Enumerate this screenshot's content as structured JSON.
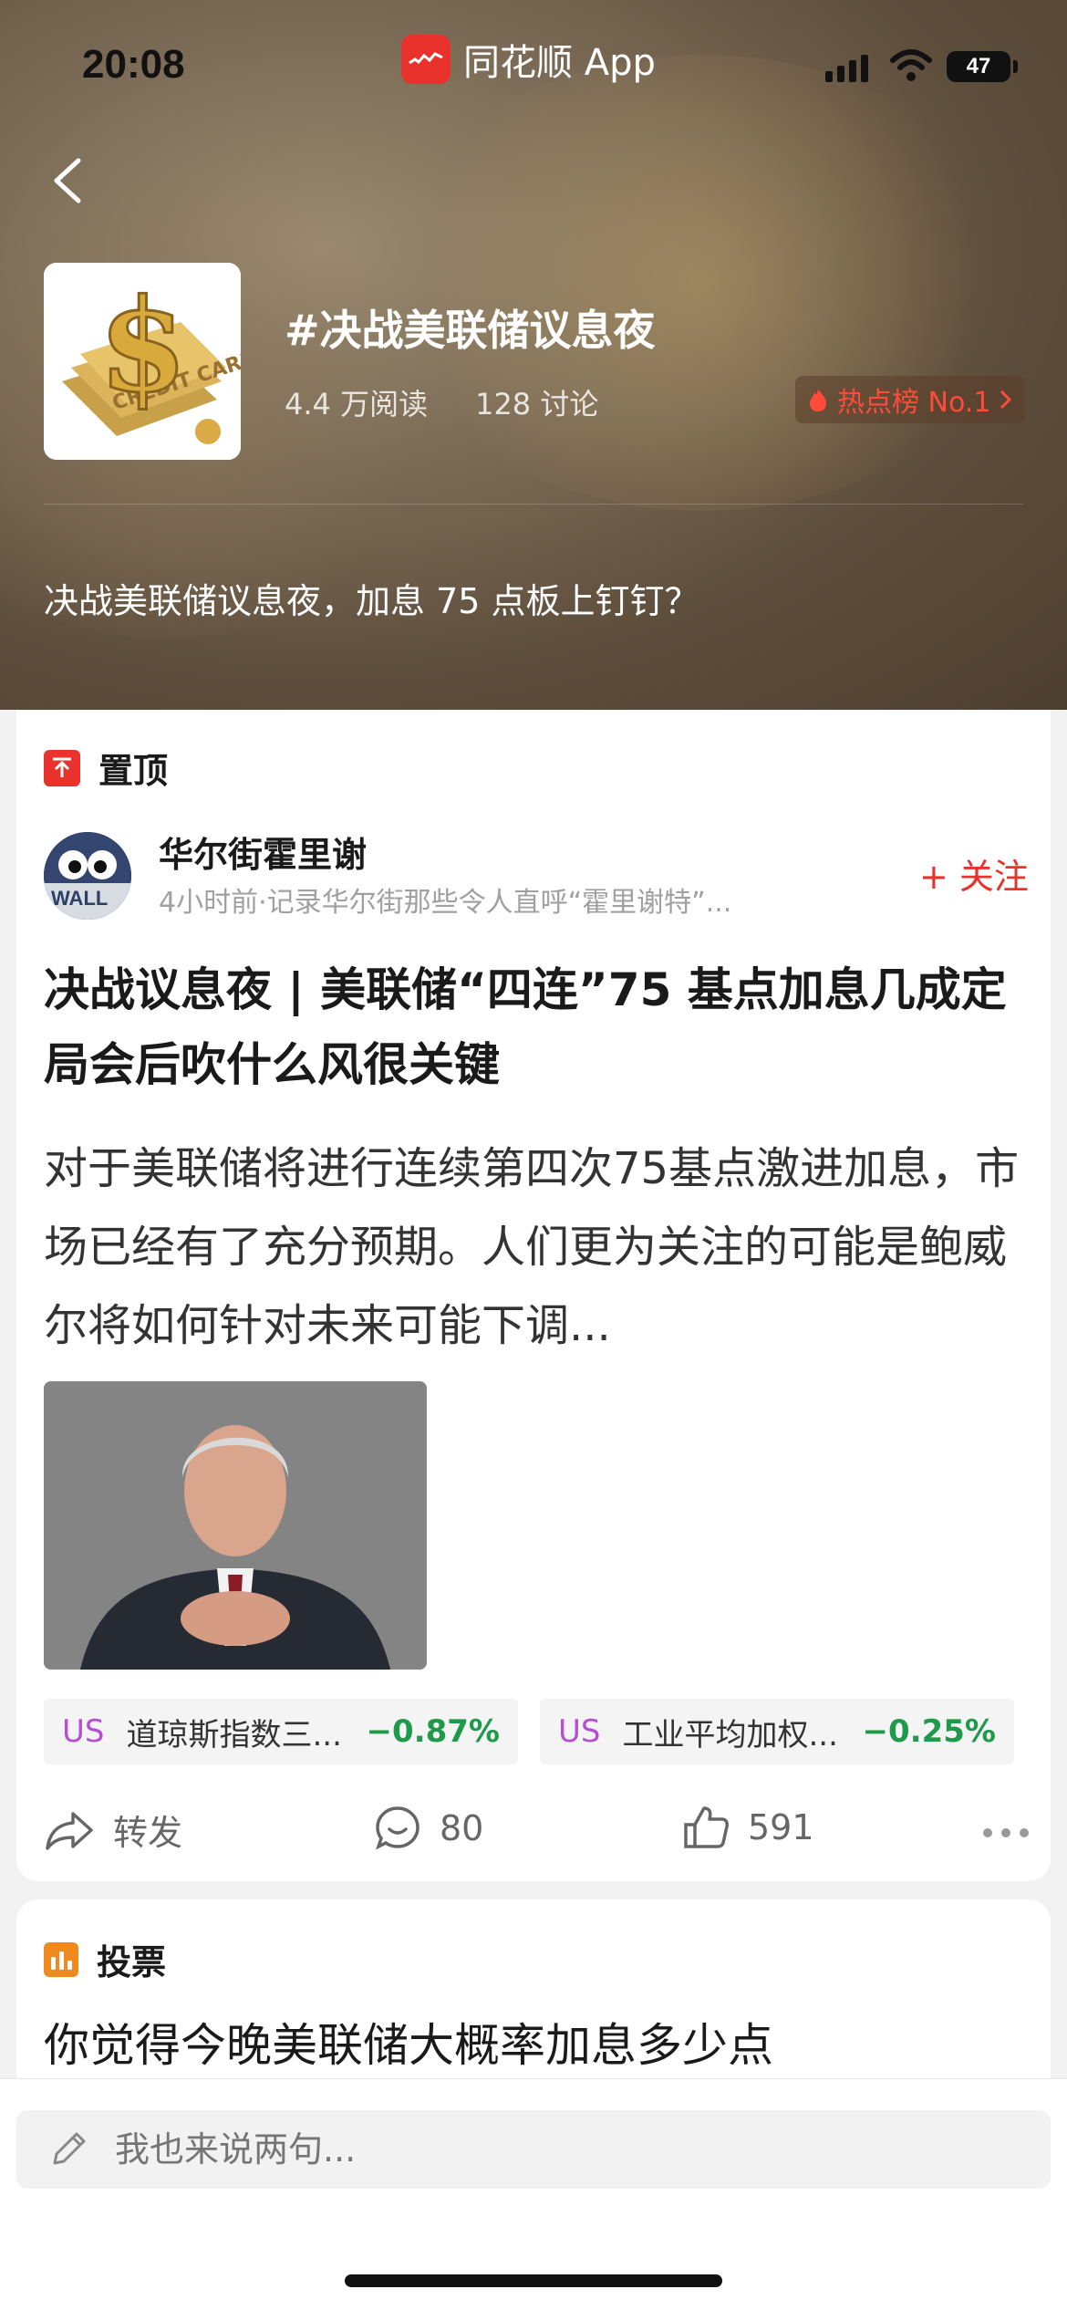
{
  "status_bar": {
    "time": "20:08",
    "app_name": "同花顺 App",
    "battery": "47"
  },
  "topic": {
    "title": "#决战美联储议息夜",
    "reads": "4.4 万阅读",
    "discussions": "128 讨论",
    "hot_rank": "热点榜 No.1",
    "description": "决战美联储议息夜，加息 75 点板上钉钉？"
  },
  "pinned_post": {
    "section_label": "置顶",
    "author": "华尔街霍里谢",
    "author_sub": "4小时前·记录华尔街那些令人直呼“霍里谢特”...",
    "follow_label": "+ 关注",
    "title": "决战议息夜 | 美联储“四连”75 基点加息几成定局会后吹什么风很关键",
    "body": "对于美联储将进行连续第四次75基点激进加息，市场已经有了充分预期。人们更为关注的可能是鲍威尔将如何针对未来可能下调...",
    "stocks": [
      {
        "market": "US",
        "name": "道琼斯指数三...",
        "change": "−0.87%"
      },
      {
        "market": "US",
        "name": "工业平均加权...",
        "change": "−0.25%"
      }
    ],
    "actions": {
      "share_label": "转发",
      "comments": "80",
      "likes": "591"
    }
  },
  "vote_post": {
    "section_label": "投票",
    "question": "你觉得今晚美联储大概率加息多少点"
  },
  "comment_input": {
    "placeholder": "我也来说两句..."
  },
  "colors": {
    "accent_red": "#e8322b",
    "down_green": "#1f9a4a",
    "us_purple": "#b44fd3",
    "vote_orange": "#f08a1f"
  }
}
